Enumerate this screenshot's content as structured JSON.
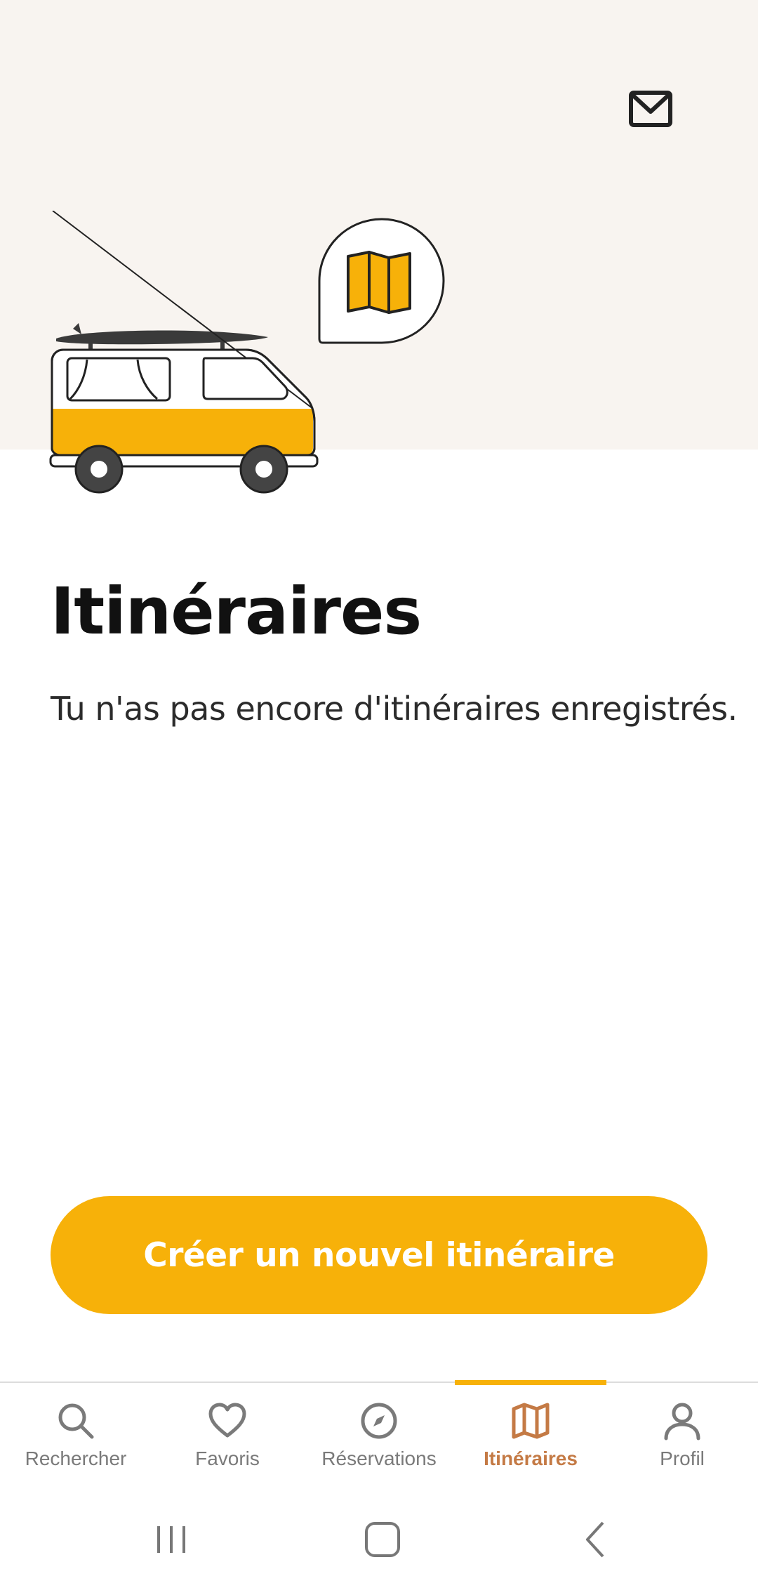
{
  "header": {
    "mail_icon": "envelope-icon"
  },
  "illustration": {
    "van_icon": "camper-van-illustration",
    "bubble_icon": "map-icon",
    "accent_color": "#f7b109"
  },
  "main": {
    "title": "Itinéraires",
    "empty_message": "Tu n'as pas encore d'itinéraires enregistrés.",
    "create_button_label": "Créer un nouvel itinéraire"
  },
  "bottom_nav": {
    "items": [
      {
        "label": "Rechercher",
        "icon": "search-icon",
        "active": false
      },
      {
        "label": "Favoris",
        "icon": "heart-icon",
        "active": false
      },
      {
        "label": "Réservations",
        "icon": "compass-icon",
        "active": false
      },
      {
        "label": "Itinéraires",
        "icon": "map-icon",
        "active": true
      },
      {
        "label": "Profil",
        "icon": "user-icon",
        "active": false
      }
    ],
    "active_color": "#c47a45",
    "inactive_color": "#7a7a7a"
  },
  "system_nav": {
    "recents_icon": "recents-icon",
    "home_icon": "home-icon",
    "back_icon": "back-icon"
  },
  "colors": {
    "hero_background": "#f8f4f0",
    "primary": "#f7b109"
  }
}
